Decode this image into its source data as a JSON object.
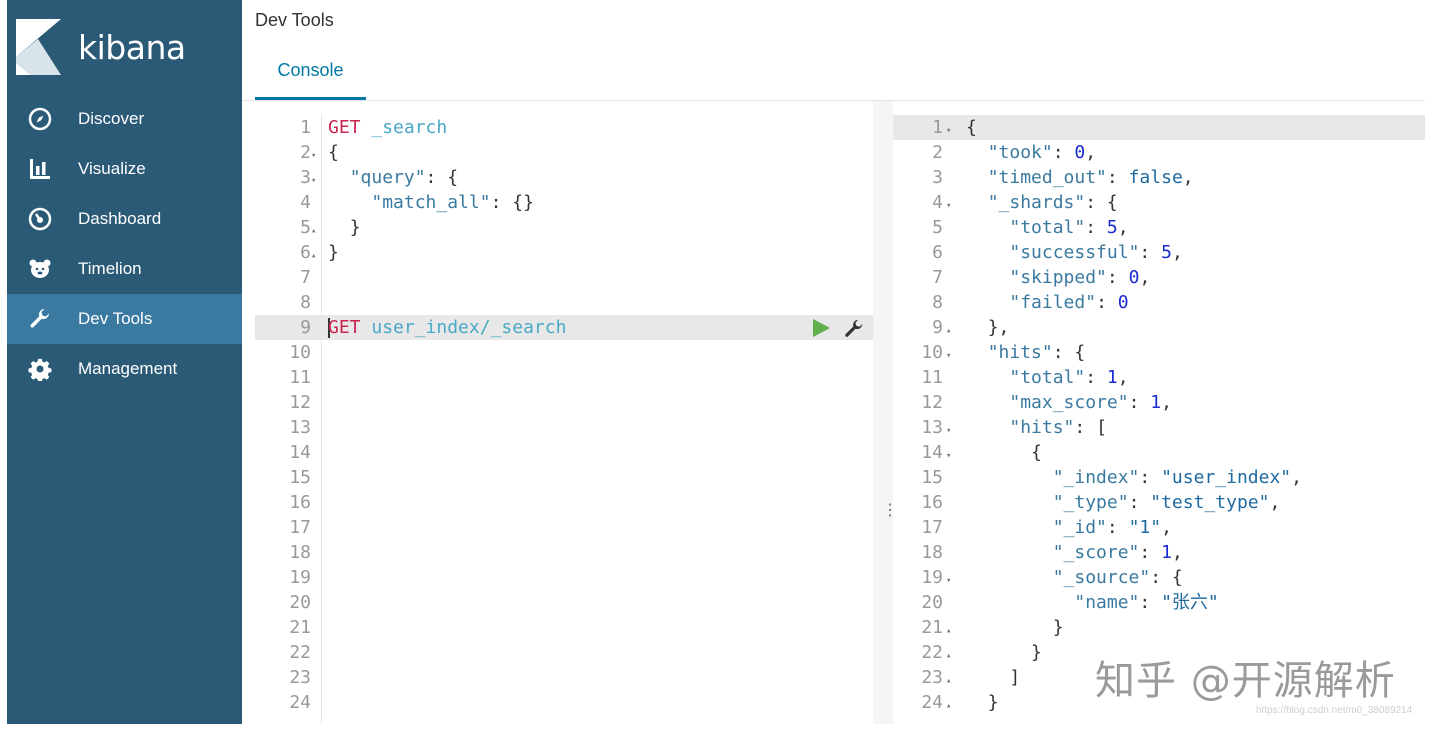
{
  "app": {
    "logo_text": "kibana",
    "title": "Dev Tools"
  },
  "sidebar": {
    "items": [
      {
        "label": "Discover",
        "icon": "compass-icon",
        "active": false
      },
      {
        "label": "Visualize",
        "icon": "bar-chart-icon",
        "active": false
      },
      {
        "label": "Dashboard",
        "icon": "dashboard-gauge-icon",
        "active": false
      },
      {
        "label": "Timelion",
        "icon": "bear-icon",
        "active": false
      },
      {
        "label": "Dev Tools",
        "icon": "wrench-icon",
        "active": true
      },
      {
        "label": "Management",
        "icon": "gear-icon",
        "active": false
      }
    ]
  },
  "tabs": {
    "console": "Console"
  },
  "request_editor": {
    "line_numbers": [
      "1",
      "2",
      "3",
      "4",
      "5",
      "6",
      "7",
      "8",
      "9",
      "10",
      "11",
      "12",
      "13",
      "14",
      "15",
      "16",
      "17",
      "18",
      "19",
      "20",
      "21",
      "22",
      "23",
      "24"
    ],
    "line1": {
      "method": "GET",
      "url": "_search"
    },
    "line2": "{",
    "line3": {
      "key": "\"query\"",
      "rest": ": {"
    },
    "line4": {
      "key": "\"match_all\"",
      "rest": ": {}"
    },
    "line5": "}",
    "line6": "}",
    "line9": {
      "method": "GET",
      "url": "user_index/_search"
    }
  },
  "response_editor": {
    "line_numbers": [
      "1",
      "2",
      "3",
      "4",
      "5",
      "6",
      "7",
      "8",
      "9",
      "10",
      "11",
      "12",
      "13",
      "14",
      "15",
      "16",
      "17",
      "18",
      "19",
      "20",
      "21",
      "22",
      "23",
      "24"
    ],
    "took": {
      "key": "\"took\"",
      "value": "0"
    },
    "timed_out": {
      "key": "\"timed_out\"",
      "value": "false"
    },
    "shards_key": "\"_shards\"",
    "total": {
      "key": "\"total\"",
      "value": "5"
    },
    "successful": {
      "key": "\"successful\"",
      "value": "5"
    },
    "skipped": {
      "key": "\"skipped\"",
      "value": "0"
    },
    "failed": {
      "key": "\"failed\"",
      "value": "0"
    },
    "hits_key": "\"hits\"",
    "hits_total": {
      "key": "\"total\"",
      "value": "1"
    },
    "max_score": {
      "key": "\"max_score\"",
      "value": "1"
    },
    "hits_inner_key": "\"hits\"",
    "index": {
      "key": "\"_index\"",
      "value": "\"user_index\""
    },
    "type": {
      "key": "\"_type\"",
      "value": "\"test_type\""
    },
    "id": {
      "key": "\"_id\"",
      "value": "\"1\""
    },
    "score": {
      "key": "\"_score\"",
      "value": "1"
    },
    "source_key": "\"_source\"",
    "name": {
      "key": "\"name\"",
      "value": "\"张六\""
    }
  },
  "watermark": {
    "text": "知乎 @开源解析",
    "small": "https://blog.csdn.net/m0_38089214"
  },
  "colors": {
    "sidebar": "#2b5a77",
    "active": "#3a7aa0",
    "accent": "#0079a5",
    "run": "#5fb04b"
  }
}
